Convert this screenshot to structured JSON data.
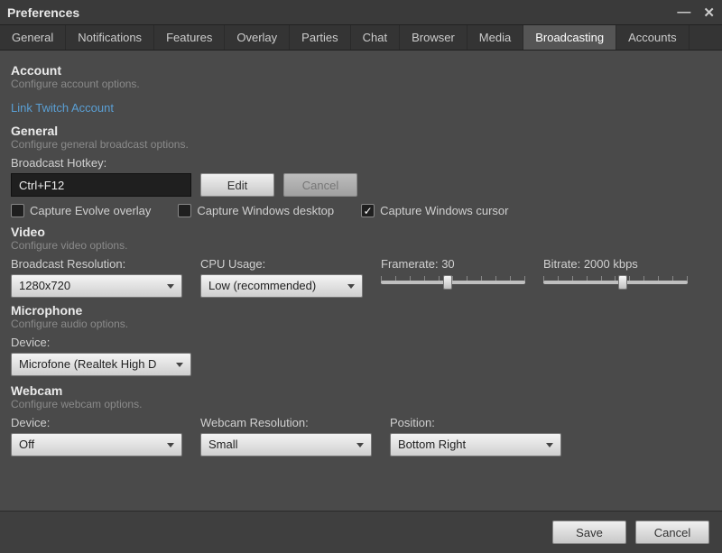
{
  "window": {
    "title": "Preferences"
  },
  "tabs": [
    "General",
    "Notifications",
    "Features",
    "Overlay",
    "Parties",
    "Chat",
    "Browser",
    "Media",
    "Broadcasting",
    "Accounts"
  ],
  "activeTab": "Broadcasting",
  "account": {
    "title": "Account",
    "desc": "Configure account options.",
    "link": "Link Twitch Account"
  },
  "general": {
    "title": "General",
    "desc": "Configure general broadcast options.",
    "hotkey_label": "Broadcast Hotkey:",
    "hotkey_value": "Ctrl+F12",
    "edit": "Edit",
    "cancel": "Cancel",
    "chk_overlay": "Capture Evolve overlay",
    "chk_desktop": "Capture Windows desktop",
    "chk_cursor": "Capture Windows cursor"
  },
  "video": {
    "title": "Video",
    "desc": "Configure video options.",
    "resolution_label": "Broadcast Resolution:",
    "resolution_value": "1280x720",
    "cpu_label": "CPU Usage:",
    "cpu_value": "Low (recommended)",
    "framerate_label": "Framerate:",
    "framerate_value": "30",
    "bitrate_label": "Bitrate:",
    "bitrate_value": "2000 kbps"
  },
  "mic": {
    "title": "Microphone",
    "desc": "Configure audio options.",
    "device_label": "Device:",
    "device_value": "Microfone (Realtek High D"
  },
  "webcam": {
    "title": "Webcam",
    "desc": "Configure webcam options.",
    "device_label": "Device:",
    "device_value": "Off",
    "res_label": "Webcam Resolution:",
    "res_value": "Small",
    "pos_label": "Position:",
    "pos_value": "Bottom Right"
  },
  "footer": {
    "save": "Save",
    "cancel": "Cancel"
  }
}
